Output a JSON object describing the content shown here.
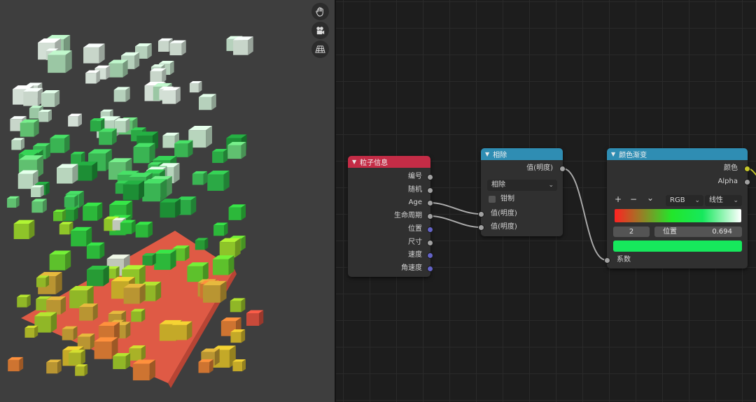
{
  "viewport": {
    "tools": [
      {
        "icon": "hand-icon"
      },
      {
        "icon": "camera-icon"
      },
      {
        "icon": "grid-plane-icon"
      }
    ],
    "colors": {
      "background": "#3e3e3e",
      "floor": "#e05a45"
    }
  },
  "node_editor": {
    "particle_info": {
      "title": "粒子信息",
      "outputs": [
        "编号",
        "随机",
        "Age",
        "生命周期",
        "位置",
        "尺寸",
        "速度",
        "角速度"
      ],
      "header_color": "#c42c46"
    },
    "divide": {
      "title": "相除",
      "output": "值(明度)",
      "operation": "相除",
      "clamp_label": "钳制",
      "inputs": [
        "值(明度)",
        "值(明度)"
      ],
      "header_color": "#2f8db3"
    },
    "color_ramp": {
      "title": "颜色渐变",
      "outputs": [
        "颜色",
        "Alpha"
      ],
      "add_label": "+",
      "remove_label": "−",
      "menu_label": "⌄",
      "color_mode": "RGB",
      "interpolation": "线性",
      "stop_index": "2",
      "position_label": "位置",
      "position_value": "0.694",
      "active_color": "#16e85c",
      "input": "系数",
      "header_color": "#2f8db3",
      "ramp_stops": [
        {
          "pos": 0.0,
          "color": "#ff2222"
        },
        {
          "pos": 0.45,
          "color": "#22e62a"
        },
        {
          "pos": 0.694,
          "color": "#16e85c"
        },
        {
          "pos": 1.0,
          "color": "#ffffff"
        }
      ]
    }
  }
}
